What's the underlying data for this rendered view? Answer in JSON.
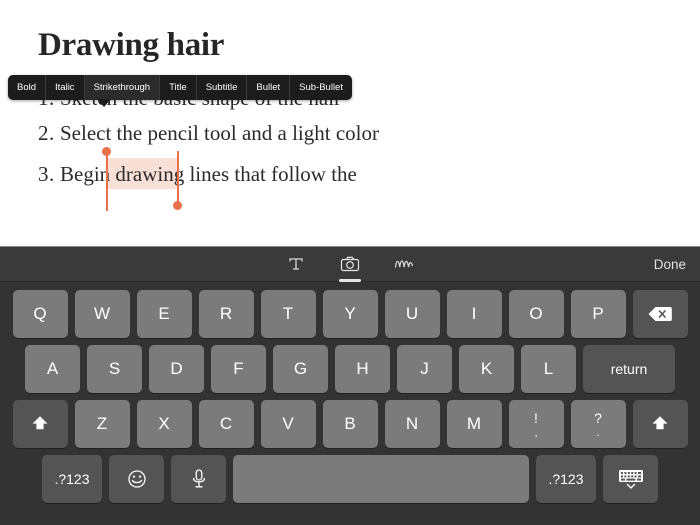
{
  "document": {
    "title": "Drawing hair",
    "lines": [
      {
        "num": "1.",
        "text": "Sketch the basic shape of the hair"
      },
      {
        "num": "2.",
        "text": "Select the pencil tool and a light color"
      },
      {
        "num": "3.",
        "text": "Begin drawing lines that follow the"
      }
    ],
    "selected_text": "drawing",
    "selection_color": "#e8714a",
    "selection_highlight_color": "#f9ddd2"
  },
  "edit_popup": {
    "items": [
      {
        "label": "Bold",
        "name": "bold"
      },
      {
        "label": "Italic",
        "name": "italic"
      },
      {
        "label": "Strikethrough",
        "name": "strikethrough"
      },
      {
        "label": "Title",
        "name": "title"
      },
      {
        "label": "Subtitle",
        "name": "subtitle"
      },
      {
        "label": "Bullet",
        "name": "bullet"
      },
      {
        "label": "Sub-Bullet",
        "name": "sub-bullet"
      }
    ],
    "active": "Strikethrough",
    "background": "#1c1c1c"
  },
  "keyboard_toolbar": {
    "icons": [
      {
        "name": "text-format-icon",
        "glyph": "T",
        "selected": false
      },
      {
        "name": "camera-icon",
        "glyph": "camera",
        "selected": true
      },
      {
        "name": "sketch-icon",
        "glyph": "squiggle",
        "selected": false
      }
    ],
    "done_label": "Done"
  },
  "keyboard": {
    "background": "#333333",
    "key_color": "#7b7b7b",
    "dark_key_color": "#545454",
    "rows": [
      {
        "name": "row-1",
        "keys": [
          {
            "label": "Q",
            "type": "letter"
          },
          {
            "label": "W",
            "type": "letter"
          },
          {
            "label": "E",
            "type": "letter"
          },
          {
            "label": "R",
            "type": "letter"
          },
          {
            "label": "T",
            "type": "letter"
          },
          {
            "label": "Y",
            "type": "letter"
          },
          {
            "label": "U",
            "type": "letter"
          },
          {
            "label": "I",
            "type": "letter"
          },
          {
            "label": "O",
            "type": "letter"
          },
          {
            "label": "P",
            "type": "letter"
          },
          {
            "label": "backspace",
            "type": "backspace"
          }
        ]
      },
      {
        "name": "row-2",
        "keys": [
          {
            "label": "A",
            "type": "letter"
          },
          {
            "label": "S",
            "type": "letter"
          },
          {
            "label": "D",
            "type": "letter"
          },
          {
            "label": "F",
            "type": "letter"
          },
          {
            "label": "G",
            "type": "letter"
          },
          {
            "label": "H",
            "type": "letter"
          },
          {
            "label": "J",
            "type": "letter"
          },
          {
            "label": "K",
            "type": "letter"
          },
          {
            "label": "L",
            "type": "letter"
          },
          {
            "label": "return",
            "type": "return"
          }
        ]
      },
      {
        "name": "row-3",
        "keys": [
          {
            "label": "shift",
            "type": "shift"
          },
          {
            "label": "Z",
            "type": "letter"
          },
          {
            "label": "X",
            "type": "letter"
          },
          {
            "label": "C",
            "type": "letter"
          },
          {
            "label": "V",
            "type": "letter"
          },
          {
            "label": "B",
            "type": "letter"
          },
          {
            "label": "N",
            "type": "letter"
          },
          {
            "label": "M",
            "type": "letter"
          },
          {
            "label": "!",
            "sub": ",",
            "type": "punct"
          },
          {
            "label": "?",
            "sub": ".",
            "type": "punct"
          },
          {
            "label": "shift",
            "type": "shift-right"
          }
        ]
      },
      {
        "name": "row-4",
        "keys": [
          {
            "label": ".?123",
            "type": "num"
          },
          {
            "label": "emoji",
            "type": "emoji"
          },
          {
            "label": "microphone",
            "type": "mic"
          },
          {
            "label": "space",
            "type": "space"
          },
          {
            "label": ".?123",
            "type": "num"
          },
          {
            "label": "hide-keyboard",
            "type": "hidekbd"
          }
        ]
      }
    ]
  }
}
